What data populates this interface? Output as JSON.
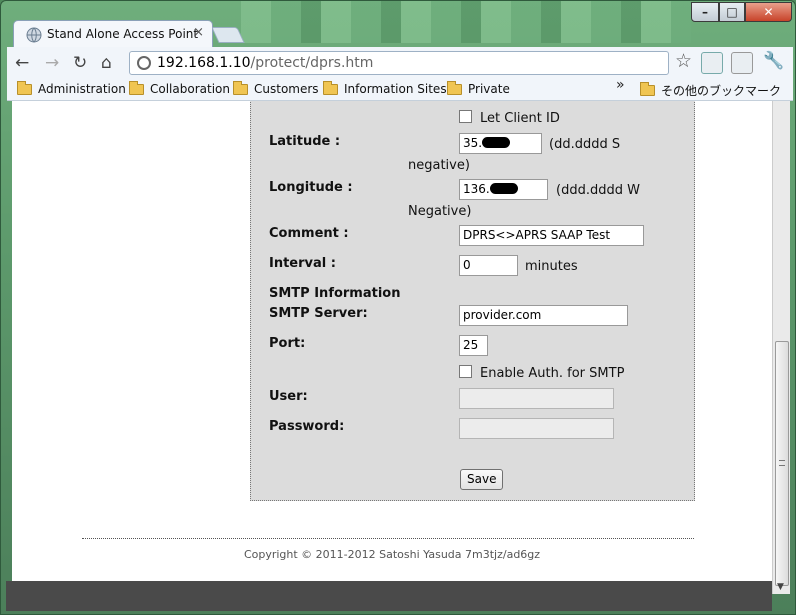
{
  "browser": {
    "tab_title": "Stand Alone Access Point",
    "tab_close": "×",
    "url_host": "192.168.1.10",
    "url_path": "/protect/dprs.htm"
  },
  "bookmarks": {
    "items": [
      "Administration",
      "Collaboration",
      "Customers",
      "Information Sites",
      "Private"
    ],
    "overflow": "»",
    "other": "その他のブックマーク"
  },
  "form": {
    "let_client_id": "Let Client ID",
    "latitude_label": "Latitude :",
    "latitude_value": "35.",
    "latitude_hint_1": "(dd.dddd S",
    "latitude_hint_2": "negative)",
    "longitude_label": "Longitude :",
    "longitude_value": "136.",
    "longitude_hint_1": "(ddd.dddd W",
    "longitude_hint_2": "Negative)",
    "comment_label": "Comment :",
    "comment_value": "DPRS<>APRS SAAP Test",
    "interval_label": "Interval :",
    "interval_value": "0",
    "interval_unit": "minutes",
    "smtp_heading": "SMTP Information",
    "smtp_server_label": "SMTP Server:",
    "smtp_server_value": "provider.com",
    "port_label": "Port:",
    "port_value": "25",
    "enable_auth": "Enable Auth. for SMTP",
    "user_label": "User:",
    "password_label": "Password:",
    "save_label": "Save"
  },
  "footer": {
    "copyright": "Copyright © 2011-2012 Satoshi Yasuda 7m3tjz/ad6gz"
  }
}
